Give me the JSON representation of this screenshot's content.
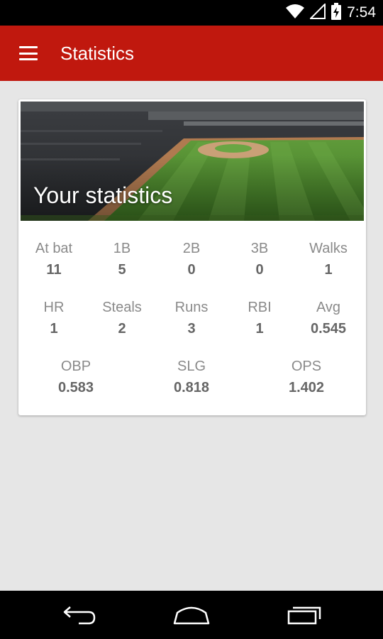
{
  "status_bar": {
    "time": "7:54",
    "icons": [
      "wifi-icon",
      "signal-icon",
      "battery-charging-icon"
    ]
  },
  "app_bar": {
    "title": "Statistics",
    "menu_icon": "hamburger-menu-icon",
    "color": "#c0180e"
  },
  "card": {
    "hero_image": "baseball-stadium-image",
    "hero_title": "Your statistics",
    "rows": [
      [
        {
          "label": "At bat",
          "value": "11"
        },
        {
          "label": "1B",
          "value": "5"
        },
        {
          "label": "2B",
          "value": "0"
        },
        {
          "label": "3B",
          "value": "0"
        },
        {
          "label": "Walks",
          "value": "1"
        }
      ],
      [
        {
          "label": "HR",
          "value": "1"
        },
        {
          "label": "Steals",
          "value": "2"
        },
        {
          "label": "Runs",
          "value": "3"
        },
        {
          "label": "RBI",
          "value": "1"
        },
        {
          "label": "Avg",
          "value": "0.545"
        }
      ],
      [
        {
          "label": "OBP",
          "value": "0.583"
        },
        {
          "label": "SLG",
          "value": "0.818"
        },
        {
          "label": "OPS",
          "value": "1.402"
        }
      ]
    ]
  },
  "nav_bar": {
    "buttons": [
      "back-icon",
      "home-icon",
      "recents-icon"
    ]
  }
}
